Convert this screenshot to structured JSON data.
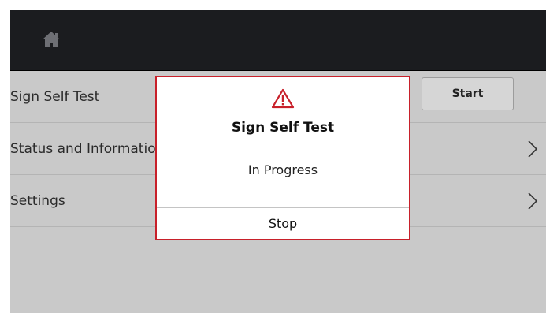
{
  "menu": {
    "rows": [
      {
        "label": "Sign Self Test",
        "action_label": "Start"
      },
      {
        "label": "Status and Information"
      },
      {
        "label": "Settings"
      }
    ]
  },
  "dialog": {
    "title": "Sign Self Test",
    "message": "In Progress",
    "stop_label": "Stop"
  },
  "colors": {
    "topbar": "#1b1c1f",
    "dialog_border": "#c8202a",
    "warning_icon": "#c8202a",
    "background": "#c9c9c9"
  },
  "icons": [
    "home-icon",
    "warning-icon",
    "chevron-right-icon"
  ]
}
